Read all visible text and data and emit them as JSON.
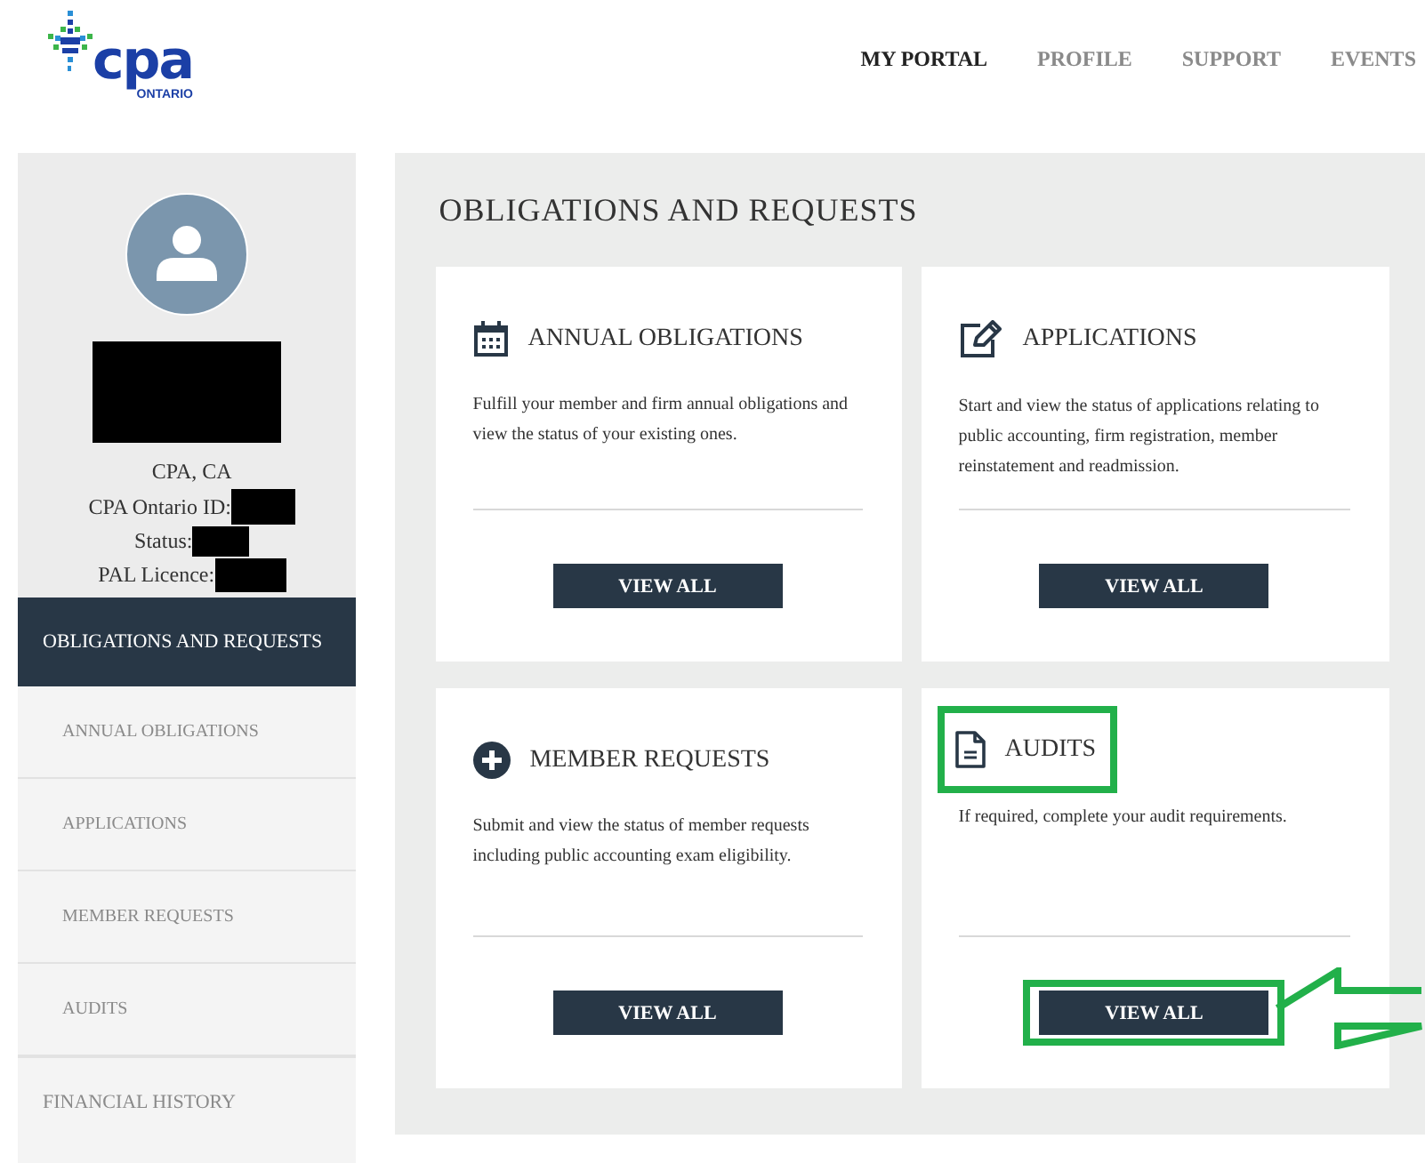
{
  "logo": {
    "wordmark": "cpa",
    "region": "ONTARIO"
  },
  "nav": [
    {
      "label": "MY PORTAL",
      "selected": true
    },
    {
      "label": "PROFILE",
      "selected": false
    },
    {
      "label": "SUPPORT",
      "selected": false
    },
    {
      "label": "EVENTS",
      "selected": false
    }
  ],
  "profile": {
    "designation": "CPA, CA",
    "fields": [
      {
        "label": "CPA Ontario ID:"
      },
      {
        "label": "Status:"
      },
      {
        "label": "PAL Licence:"
      }
    ]
  },
  "sidebar": {
    "items": [
      {
        "label": "OBLIGATIONS AND REQUESTS",
        "selected": true,
        "children": [
          {
            "label": "ANNUAL OBLIGATIONS"
          },
          {
            "label": "APPLICATIONS"
          },
          {
            "label": "MEMBER REQUESTS"
          },
          {
            "label": "AUDITS"
          }
        ]
      },
      {
        "label": "FINANCIAL HISTORY",
        "selected": false
      }
    ]
  },
  "main": {
    "title": "OBLIGATIONS AND REQUESTS",
    "cards": [
      {
        "kind": "calendar",
        "title": "ANNUAL OBLIGATIONS",
        "text": "Fulfill your member and firm annual obligations and view the status of your existing ones.",
        "button": "VIEW ALL",
        "highlighted": false
      },
      {
        "kind": "edit",
        "title": "APPLICATIONS",
        "text": "Start and view the status of applications relating to public accounting, firm registration, member reinstatement and readmission.",
        "button": "VIEW ALL",
        "highlighted": false
      },
      {
        "kind": "plus",
        "title": "MEMBER REQUESTS",
        "text": "Submit and view the status of member requests including public accounting exam eligibility.",
        "button": "VIEW ALL",
        "highlighted": false
      },
      {
        "kind": "document",
        "title": "AUDITS",
        "text": "If required, complete your audit requirements.",
        "button": "VIEW ALL",
        "highlighted": true
      }
    ]
  }
}
